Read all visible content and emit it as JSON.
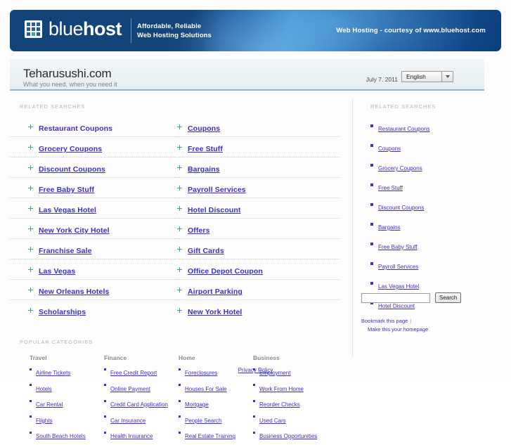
{
  "banner": {
    "logo_text_light": "blue",
    "logo_text_bold": "host",
    "tagline_line1": "Affordable, Reliable",
    "tagline_line2": "Web Hosting Solutions",
    "courtesy": "Web Hosting - courtesy of www.bluehost.com",
    "accent_color": "#14467f"
  },
  "titlebar": {
    "site_title": "Teharusushi.com",
    "tagline": "What you need, when you need it",
    "date": "July 7. 2011",
    "language_selected": "English"
  },
  "main": {
    "related_heading": "RELATED SEARCHES",
    "related_col1": [
      "Restaurant Coupons",
      "Grocery Coupons",
      "Discount Coupons",
      "Free Baby Stuff",
      "Las Vegas Hotel",
      "New York City Hotel",
      "Franchise Sale",
      "Las Vegas",
      "New Orleans Hotels",
      "Scholarships"
    ],
    "related_col2": [
      "Coupons",
      "Free Stuff",
      "Bargains",
      "Payroll Services",
      "Hotel Discount",
      "Offers",
      "Gift Cards",
      "Office Depot Coupon",
      "Airport Parking",
      "New York Hotel"
    ],
    "popular_heading": "POPULAR CATEGORIES",
    "categories": [
      {
        "title": "Travel",
        "items": [
          "Airline Tickets",
          "Hotels",
          "Car Rental",
          "Flights",
          "South Beach Hotels"
        ]
      },
      {
        "title": "Finance",
        "items": [
          "Free Credit Report",
          "Online Payment",
          "Credit Card Application",
          "Car Insurance",
          "Health Insurance"
        ]
      },
      {
        "title": "Home",
        "items": [
          "Foreclosures",
          "Houses For Sale",
          "Mortgage",
          "People Search",
          "Real Estate Training"
        ]
      },
      {
        "title": "Business",
        "items": [
          "Employment",
          "Work From Home",
          "Reorder Checks",
          "Used Cars",
          "Business Opportunities"
        ]
      }
    ]
  },
  "sidebar": {
    "heading": "RELATED SEARCHES",
    "items": [
      "Restaurant Coupons",
      "Coupons",
      "Grocery Coupons",
      "Free Stuff",
      "Discount Coupons",
      "Bargains",
      "Free Baby Stuff",
      "Payroll Services",
      "Las Vegas Hotel",
      "Hotel Discount"
    ],
    "search_value": "",
    "search_placeholder": "",
    "search_button": "Search",
    "bookmark_label": "Bookmark this page",
    "bookmark_separator": "|",
    "homepage_label": "Make this your homepage"
  },
  "footer": {
    "privacy": "Privacy Policy"
  }
}
